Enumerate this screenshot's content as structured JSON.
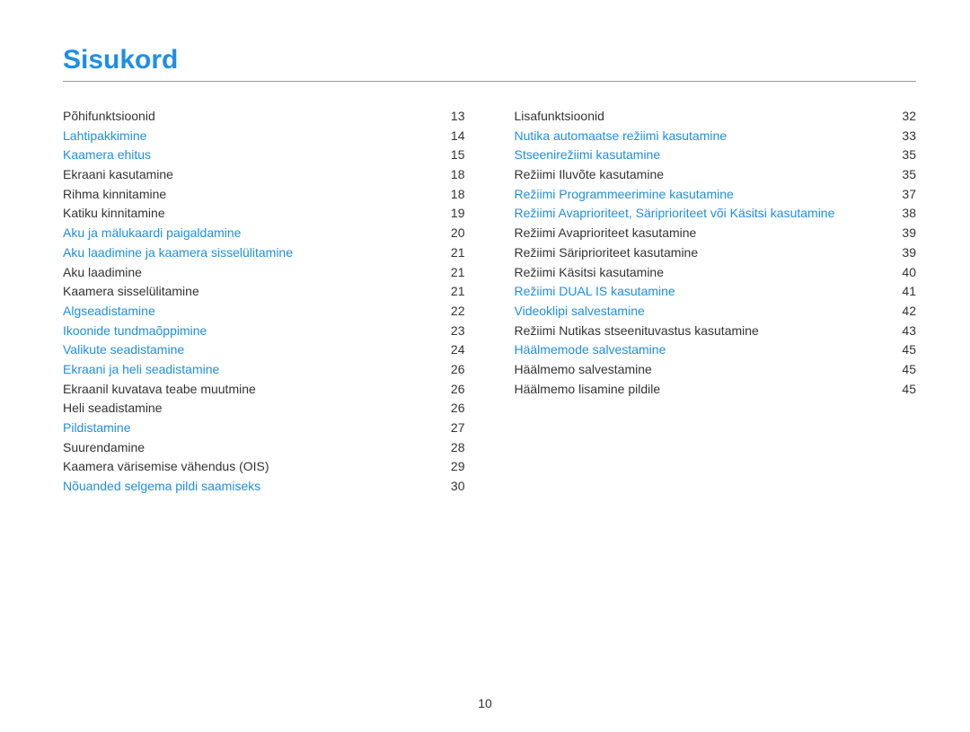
{
  "title": "Sisukord",
  "page_number": "10",
  "left_column": [
    {
      "label": "Põhifunktsioonid",
      "page": "13",
      "link": false
    },
    {
      "label": "Lahtipakkimine",
      "page": "14",
      "link": true
    },
    {
      "label": "Kaamera ehitus",
      "page": "15",
      "link": true
    },
    {
      "label": "Ekraani kasutamine",
      "page": "18",
      "link": false
    },
    {
      "label": "Rihma kinnitamine",
      "page": "18",
      "link": false
    },
    {
      "label": "Katiku kinnitamine",
      "page": "19",
      "link": false
    },
    {
      "label": "Aku ja mälukaardi paigaldamine",
      "page": "20",
      "link": true
    },
    {
      "label": "Aku laadimine ja kaamera sisselülitamine",
      "page": "21",
      "link": true
    },
    {
      "label": "Aku laadimine",
      "page": "21",
      "link": false
    },
    {
      "label": "Kaamera sisselülitamine",
      "page": "21",
      "link": false
    },
    {
      "label": "Algseadistamine",
      "page": "22",
      "link": true
    },
    {
      "label": "Ikoonide tundmaõppimine",
      "page": "23",
      "link": true
    },
    {
      "label": "Valikute seadistamine",
      "page": "24",
      "link": true
    },
    {
      "label": "Ekraani ja heli seadistamine",
      "page": "26",
      "link": true
    },
    {
      "label": "Ekraanil kuvatava teabe muutmine",
      "page": "26",
      "link": false
    },
    {
      "label": "Heli seadistamine",
      "page": "26",
      "link": false
    },
    {
      "label": "Pildistamine",
      "page": "27",
      "link": true
    },
    {
      "label": "Suurendamine",
      "page": "28",
      "link": false
    },
    {
      "label": "Kaamera värisemise vähendus (OIS)",
      "page": "29",
      "link": false
    },
    {
      "label": "Nõuanded selgema pildi saamiseks",
      "page": "30",
      "link": true
    }
  ],
  "right_column": [
    {
      "label": "Lisafunktsioonid",
      "page": "32",
      "link": false
    },
    {
      "label": "Nutika automaatse režiimi kasutamine",
      "page": "33",
      "link": true
    },
    {
      "label": "Stseenirežiimi kasutamine",
      "page": "35",
      "link": true
    },
    {
      "label": "Režiimi Iluvõte kasutamine",
      "page": "35",
      "link": false
    },
    {
      "label": "Režiimi Programmeerimine kasutamine",
      "page": "37",
      "link": true
    },
    {
      "label": "Režiimi Avaprioriteet, Säriprioriteet või Käsitsi kasutamine",
      "page": "38",
      "link": true
    },
    {
      "label": "Režiimi Avaprioriteet kasutamine",
      "page": "39",
      "link": false
    },
    {
      "label": "Režiimi Säriprioriteet kasutamine",
      "page": "39",
      "link": false
    },
    {
      "label": "Režiimi Käsitsi kasutamine",
      "page": "40",
      "link": false
    },
    {
      "label": "Režiimi DUAL IS kasutamine",
      "page": "41",
      "link": true
    },
    {
      "label": "Videoklipi salvestamine",
      "page": "42",
      "link": true
    },
    {
      "label": "Režiimi Nutikas stseenituvastus kasutamine",
      "page": "43",
      "link": false
    },
    {
      "label": "Häälmemode salvestamine",
      "page": "45",
      "link": true
    },
    {
      "label": "Häälmemo salvestamine",
      "page": "45",
      "link": false
    },
    {
      "label": "Häälmemo lisamine pildile",
      "page": "45",
      "link": false
    }
  ]
}
